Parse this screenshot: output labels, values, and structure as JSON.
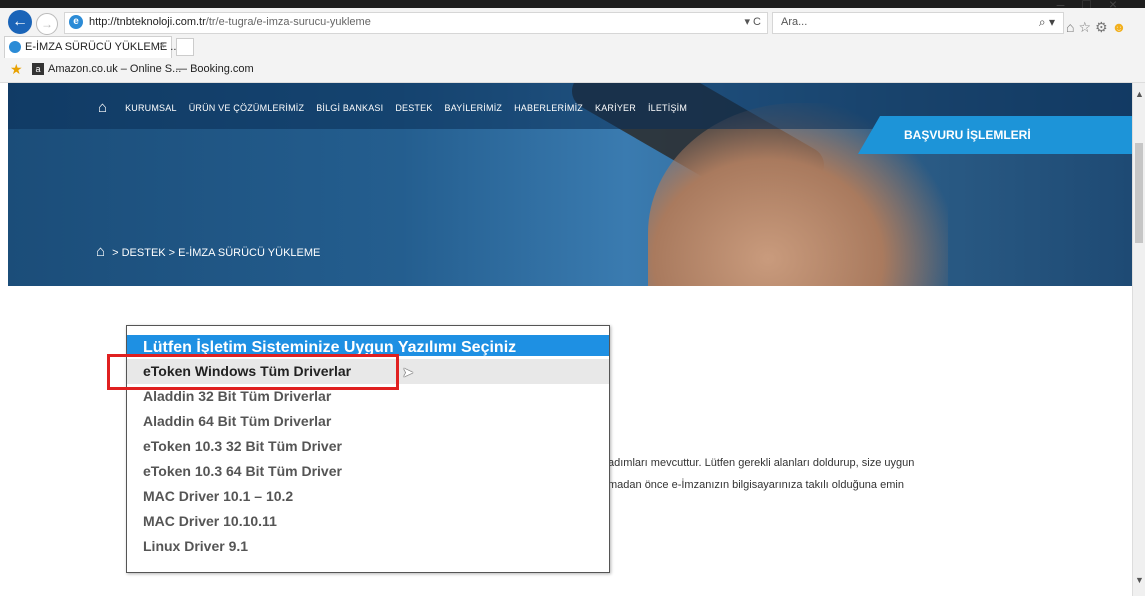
{
  "browser": {
    "url_domain": "http://tnbteknoloji.com.tr",
    "url_path": "/tr/e-tugra/e-imza-surucu-yukleme",
    "url_ctrl": "▾ C",
    "search_placeholder": "Ara...",
    "tab_title": "E-İMZA SÜRÜCÜ YÜKLEME ...",
    "tab_close": "×",
    "favorites": [
      "Amazon.co.uk – Online S...",
      "Booking.com"
    ],
    "icons": [
      "back-arrow-icon",
      "forward-arrow-icon",
      "ie-icon",
      "search-icon",
      "home-icon",
      "star-icon",
      "gear-icon",
      "smiley-icon"
    ]
  },
  "site": {
    "nav": [
      "KURUMSAL",
      "ÜRÜN VE ÇÖZÜMLERİMİZ",
      "BİLGİ BANKASI",
      "DESTEK",
      "BAYİLERİMİZ",
      "HABERLERİMİZ",
      "KARİYER",
      "İLETİŞİM"
    ],
    "basvuru": "BAŞVURU İŞLEMLERİ",
    "breadcrumb": "> DESTEK > E-İMZA SÜRÜCÜ YÜKLEME",
    "body_line1": "adımları mevcuttur. Lütfen gerekli alanları doldurup, size uygun",
    "body_line2": "madan önce e-İmzanızın bilgisayarınıza takılı olduğuna emin"
  },
  "dropdown": {
    "header": "Lütfen İşletim Sisteminize Uygun Yazılımı Seçiniz",
    "items": [
      "eToken Windows Tüm Driverlar",
      "Aladdin 32 Bit Tüm Driverlar",
      "Aladdin 64 Bit Tüm Driverlar",
      "eToken 10.3 32 Bit Tüm Driver",
      "eToken 10.3 64 Bit Tüm Driver",
      "MAC Driver 10.1 – 10.2",
      "MAC Driver 10.10.11",
      "Linux Driver 9.1"
    ],
    "highlighted_index": 0
  },
  "colors": {
    "accent_blue": "#1e90e3",
    "highlight_red": "#e02020",
    "header_navy": "#1b4d79"
  }
}
